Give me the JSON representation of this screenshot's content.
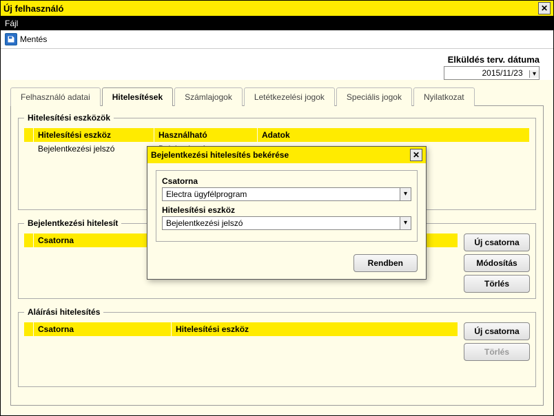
{
  "titlebar": {
    "title": "Új felhasználó"
  },
  "menu": {
    "file": "Fájl"
  },
  "toolbar": {
    "save_label": "Mentés"
  },
  "date": {
    "label": "Elküldés terv. dátuma",
    "value": "2015/11/23"
  },
  "tabs": [
    {
      "label": "Felhasználó adatai"
    },
    {
      "label": "Hitelesítések"
    },
    {
      "label": "Számlajogok"
    },
    {
      "label": "Letétkezelési jogok"
    },
    {
      "label": "Speciális jogok"
    },
    {
      "label": "Nyilatkozat"
    }
  ],
  "active_tab": 1,
  "tools_fs": {
    "legend": "Hitelesítési eszközök",
    "headers": {
      "tool": "Hitelesítési eszköz",
      "usable": "Használható",
      "data": "Adatok"
    },
    "row": {
      "tool": "Bejelentkezési jelszó",
      "usable": "Bejelentkezés"
    }
  },
  "login_fs": {
    "legend": "Bejelentkezési hitelesít",
    "headers": {
      "channel": "Csatorna"
    }
  },
  "sign_fs": {
    "legend": "Aláírási hitelesítés",
    "headers": {
      "channel": "Csatorna",
      "tool": "Hitelesítési eszköz"
    }
  },
  "buttons": {
    "new_channel": "Új csatorna",
    "modify": "Módosítás",
    "delete": "Törlés"
  },
  "dialog": {
    "title": "Bejelentkezési hitelesítés bekérése",
    "channel_label": "Csatorna",
    "channel_value": "Electra ügyfélprogram",
    "tool_label": "Hitelesítési eszköz",
    "tool_value": "Bejelentkezési jelszó",
    "ok": "Rendben"
  }
}
